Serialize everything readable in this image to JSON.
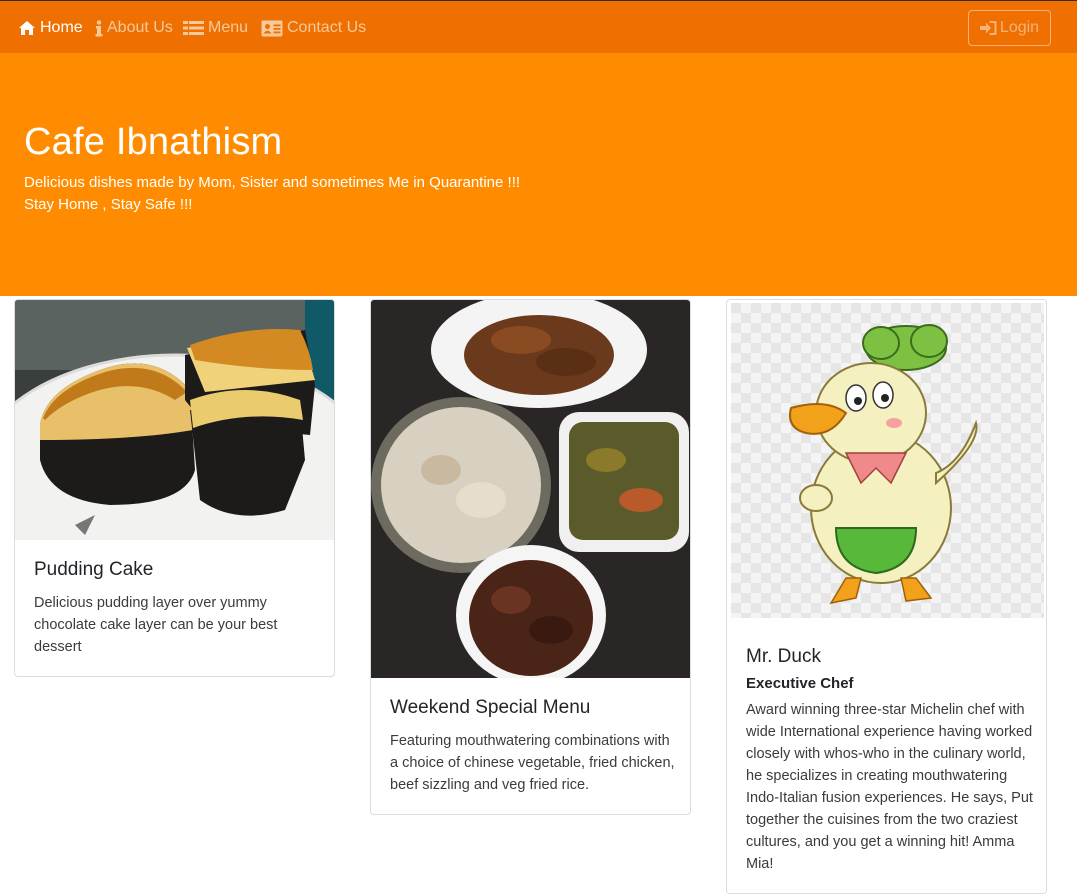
{
  "nav": {
    "items": [
      {
        "label": "Home",
        "icon": "home-icon",
        "active": true
      },
      {
        "label": "About Us",
        "icon": "info-icon",
        "active": false
      },
      {
        "label": "Menu",
        "icon": "list-icon",
        "active": false
      },
      {
        "label": "Contact Us",
        "icon": "address-card-icon",
        "active": false
      }
    ],
    "login_label": "Login",
    "login_icon": "sign-in-icon"
  },
  "hero": {
    "title": "Cafe Ibnathism",
    "line1": "Delicious dishes made by Mom, Sister and sometimes Me in Quarantine !!!",
    "line2": "Stay Home , Stay Safe !!!"
  },
  "cards": [
    {
      "title": "Pudding Cake",
      "text": "Delicious pudding layer over yummy chocolate cake layer can be your best dessert"
    },
    {
      "title": "Weekend Special Menu",
      "text": "Featuring mouthwatering combinations with a choice of chinese vegetable, fried chicken, beef sizzling and veg fried rice."
    },
    {
      "title": "Mr. Duck",
      "subtitle": "Executive Chef",
      "text": "Award winning three-star Michelin chef with wide International experience having worked closely with whos-who in the culinary world, he specializes in creating mouthwatering Indo-Italian fusion experiences. He says, Put together the cuisines from the two craziest cultures, and you get a winning hit! Amma Mia!"
    }
  ],
  "colors": {
    "navbar": "#ef7000",
    "hero": "#ff8c00",
    "nav_inactive": "#f7c99b",
    "nav_active": "#ffffff"
  }
}
